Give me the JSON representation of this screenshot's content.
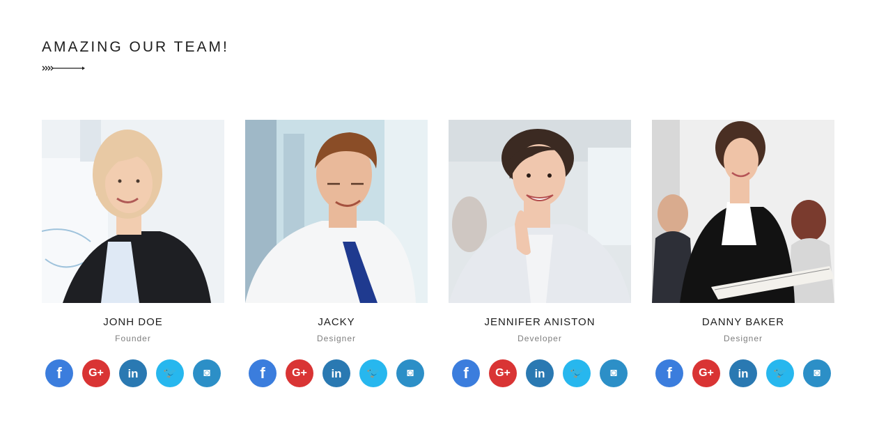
{
  "section": {
    "title": "AMAZING OUR TEAM!"
  },
  "members": [
    {
      "name": "JONH DOE",
      "role": "Founder",
      "photo": {
        "bg": "#e9eef2",
        "hair": "#e8c9a4",
        "skin": "#f2cdb0",
        "suit": "#1e1f23",
        "shirt": "#dfe9f5"
      }
    },
    {
      "name": "JACKY",
      "role": "Designer",
      "photo": {
        "bg": "#c9dfe7",
        "hair": "#8a4d27",
        "skin": "#e9b99a",
        "suit": "#f5f6f7",
        "shirt": "#ffffff",
        "tie": "#1f3a8f"
      }
    },
    {
      "name": "JENNIFER ANISTON",
      "role": "Developer",
      "photo": {
        "bg": "#e2e7ea",
        "hair": "#3b2a22",
        "skin": "#f0c7ae",
        "suit": "#e6e9ee",
        "shirt": "#f3f4f6"
      }
    },
    {
      "name": "DANNY BAKER",
      "role": "Designer",
      "photo": {
        "bg": "#efefef",
        "hair": "#4a2f23",
        "skin": "#efc3a7",
        "suit": "#121212",
        "shirt": "#ffffff"
      }
    }
  ],
  "social": [
    {
      "name": "facebook",
      "glyph": "f",
      "color": "#3b7ddd"
    },
    {
      "name": "google-plus",
      "glyph": "G+",
      "color": "#d93434"
    },
    {
      "name": "linkedin",
      "glyph": "in",
      "color": "#2a79b2"
    },
    {
      "name": "twitter",
      "glyph": "🐦",
      "color": "#27b7ee"
    },
    {
      "name": "instagram",
      "glyph": "◙",
      "color": "#2c8fc7"
    }
  ]
}
